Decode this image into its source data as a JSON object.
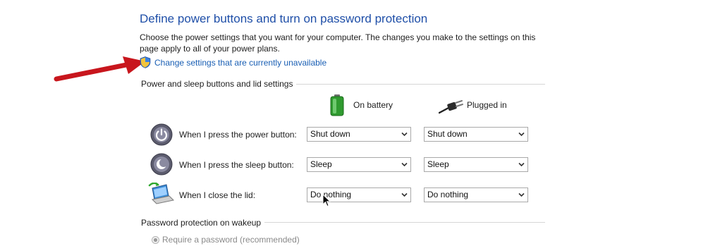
{
  "header": {
    "title": "Define power buttons and turn on password protection",
    "description": "Choose the power settings that you want for your computer. The changes you make to the settings on this page apply to all of your power plans.",
    "change_link": "Change settings that are currently unavailable"
  },
  "power_sleep": {
    "section_title": "Power and sleep buttons and lid settings",
    "columns": {
      "battery": "On battery",
      "plugged": "Plugged in"
    },
    "rows": [
      {
        "label": "When I press the power button:",
        "icon": "power-button-icon",
        "battery": "Shut down",
        "plugged": "Shut down"
      },
      {
        "label": "When I press the sleep button:",
        "icon": "sleep-button-icon",
        "battery": "Sleep",
        "plugged": "Sleep"
      },
      {
        "label": "When I close the lid:",
        "icon": "laptop-lid-icon",
        "battery": "Do nothing",
        "plugged": "Do nothing"
      }
    ]
  },
  "password": {
    "section_title": "Password protection on wakeup",
    "option_label": "Require a password (recommended)"
  },
  "colors": {
    "title_blue": "#1f4fa8",
    "link_blue": "#1a5fb4",
    "annotation_arrow": "#c8161d"
  }
}
